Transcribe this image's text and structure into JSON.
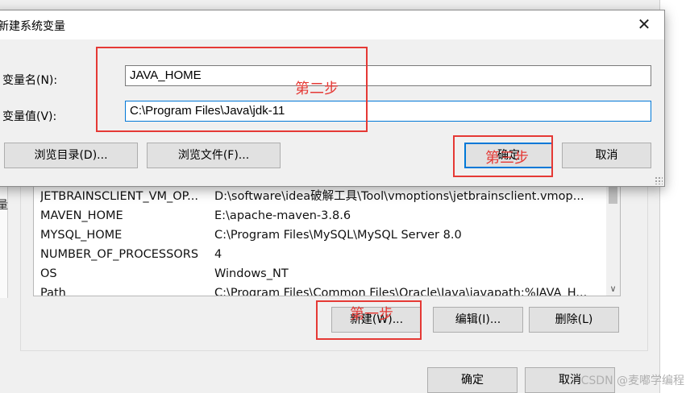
{
  "background_window": {
    "edge_fragment": "量",
    "variables": [
      {
        "name": "JETBRAINSCLIENT_VM_OP...",
        "value": "D:\\software\\idea破解工具\\Tool\\vmoptions\\jetbrainsclient.vmop..."
      },
      {
        "name": "MAVEN_HOME",
        "value": "E:\\apache-maven-3.8.6"
      },
      {
        "name": "MYSQL_HOME",
        "value": "C:\\Program Files\\MySQL\\MySQL Server 8.0"
      },
      {
        "name": "NUMBER_OF_PROCESSORS",
        "value": "4"
      },
      {
        "name": "OS",
        "value": "Windows_NT"
      },
      {
        "name": "Path",
        "value": "C:\\Program Files\\Common Files\\Oracle\\Java\\javapath;%JAVA_H..."
      }
    ],
    "buttons": {
      "new": "新建(W)...",
      "edit": "编辑(I)...",
      "delete": "删除(L)"
    },
    "footer": {
      "ok": "确定",
      "cancel": "取消"
    }
  },
  "dialog": {
    "title": "新建系统变量",
    "name_label": "变量名(N):",
    "name_value": "JAVA_HOME",
    "value_label": "变量值(V):",
    "value_value": "C:\\Program Files\\Java\\jdk-11",
    "browse_dir": "浏览目录(D)...",
    "browse_file": "浏览文件(F)...",
    "ok": "确定",
    "cancel": "取消"
  },
  "annotations": {
    "step1": "第一步",
    "step2": "第二步",
    "step3": "第三步"
  },
  "watermark": "CSDN @麦嘟学编程",
  "colors": {
    "annotation": "#e53935",
    "focus": "#0078d7"
  }
}
